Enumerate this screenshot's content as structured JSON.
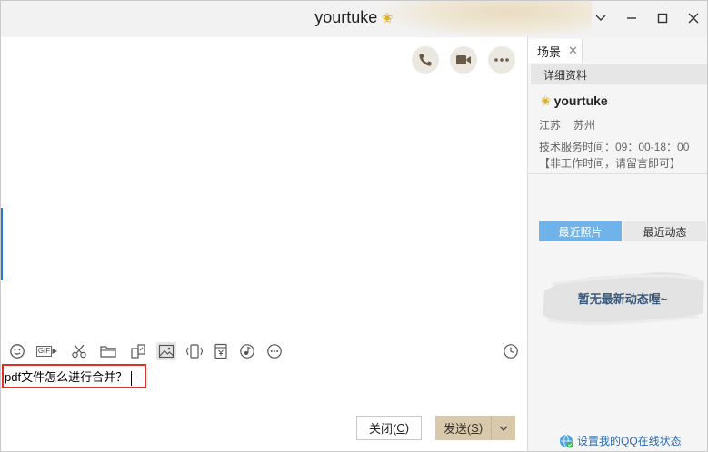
{
  "window": {
    "title": "yourtuke",
    "controls": [
      "chevron-down-icon",
      "minimize-icon",
      "maximize-icon",
      "close-icon"
    ]
  },
  "chat": {
    "actions": [
      "phone-icon",
      "video-icon",
      "more-icon"
    ]
  },
  "toolbar": {
    "items": [
      "emoji-icon",
      "gif-icon",
      "scissors-icon",
      "folder-icon",
      "shapes-icon",
      "image-icon",
      "shake-icon",
      "red-packet-icon",
      "music-icon",
      "more-icon",
      "history-clock-icon"
    ],
    "gif_label": "GIF"
  },
  "input": {
    "value": "pdf文件怎么进行合并？"
  },
  "buttons": {
    "close_label": "关闭(",
    "close_key": "C",
    "close_suffix": ")",
    "send_label": "发送(",
    "send_key": "S",
    "send_suffix": ")"
  },
  "panel": {
    "tab_label": "场景",
    "section_title": "详细资料",
    "profile_name": "yourtuke",
    "province": "江苏",
    "city": "苏州",
    "service_hours": "技术服务时间：09：00-18：00【非工作时间，请留言即可】",
    "tab_photos": "最近照片",
    "tab_news": "最近动态",
    "empty_message": "暂无最新动态喔~",
    "qq_status_link": "设置我的QQ在线状态"
  },
  "colors": {
    "accent_blue": "#6fb3ea",
    "send_button": "#d8c9ad",
    "highlight_red": "#d9312b",
    "star_gold": "#e0b020"
  }
}
